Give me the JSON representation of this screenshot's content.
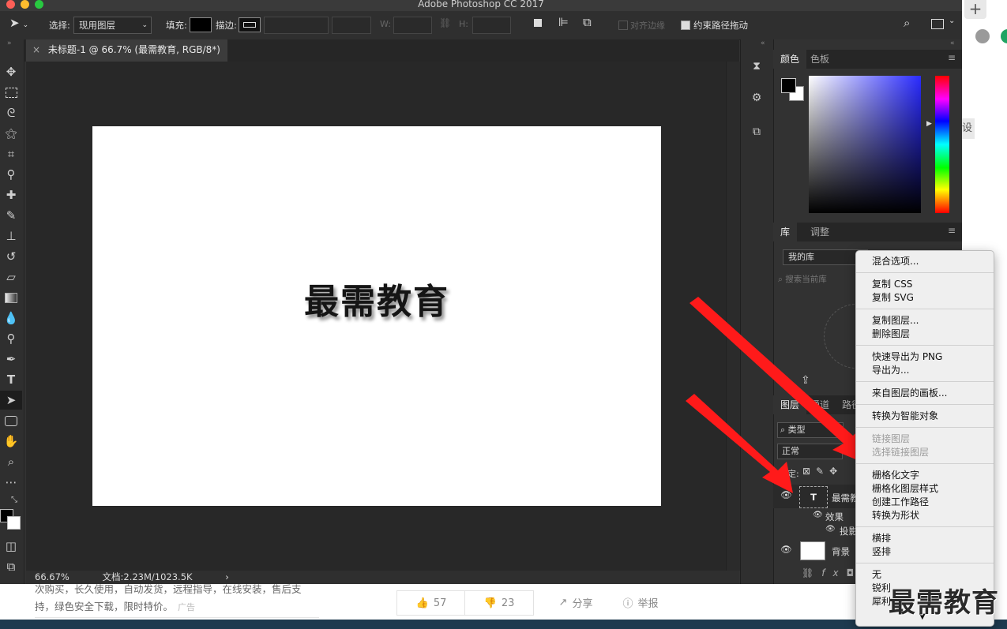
{
  "app_title": "Adobe Photoshop CC 2017",
  "options_bar": {
    "select_label": "选择:",
    "select_value": "现用图层",
    "fill_label": "填充:",
    "stroke_label": "描边:",
    "w_label": "W:",
    "h_label": "H:",
    "align_edges_label": "对齐边缘",
    "constrain_path_label": "约束路径拖动"
  },
  "document": {
    "tab_title": "未标题-1 @ 66.7% (最需教育, RGB/8*) *",
    "canvas_text": "最需教育",
    "zoom": "66.67%",
    "doc_info": "文档:2.23M/1023.5K"
  },
  "panels": {
    "color_tab": "颜色",
    "swatches_tab": "色板",
    "library_tab": "库",
    "adjust_tab": "调整",
    "library_select": "我的库",
    "library_search_placeholder": "搜索当前库",
    "layers_tab": "图层",
    "channels_tab": "通道",
    "paths_tab": "路径",
    "kind_filter": "类型",
    "blend_mode": "正常",
    "lock_label": "锁定:",
    "layers": [
      {
        "name": "最需教育"
      },
      {
        "name": "效果"
      },
      {
        "name": "投影"
      },
      {
        "name": "背景"
      }
    ]
  },
  "context_menu": {
    "groups": [
      [
        {
          "label": "混合选项..."
        }
      ],
      [
        {
          "label": "复制 CSS"
        },
        {
          "label": "复制 SVG"
        }
      ],
      [
        {
          "label": "复制图层..."
        },
        {
          "label": "删除图层"
        }
      ],
      [
        {
          "label": "快速导出为 PNG"
        },
        {
          "label": "导出为..."
        }
      ],
      [
        {
          "label": "来自图层的画板..."
        }
      ],
      [
        {
          "label": "转换为智能对象"
        }
      ],
      [
        {
          "label": "链接图层",
          "disabled": true
        },
        {
          "label": "选择链接图层",
          "disabled": true
        }
      ],
      [
        {
          "label": "栅格化文字"
        },
        {
          "label": "栅格化图层样式"
        },
        {
          "label": "创建工作路径"
        },
        {
          "label": "转换为形状"
        }
      ],
      [
        {
          "label": "横排"
        },
        {
          "label": "竖排"
        }
      ],
      [
        {
          "label": "无"
        },
        {
          "label": "锐利"
        },
        {
          "label": "犀利"
        }
      ]
    ]
  },
  "web_page": {
    "side_button_char": "设",
    "snippet_line1": "次购买，长久使用，自动发货，远程指导，在线安装，售后支",
    "snippet_line2": "持，绿色安全下载，限时特价。",
    "ad_tag": "广告",
    "likes": "57",
    "dislikes": "23",
    "share_label": "分享",
    "report_label": "举报"
  },
  "watermark": "最需教育",
  "colors": {
    "arrow": "#ff1a1a",
    "ps_dark": "#323232",
    "menu_bg": "#efefef"
  }
}
